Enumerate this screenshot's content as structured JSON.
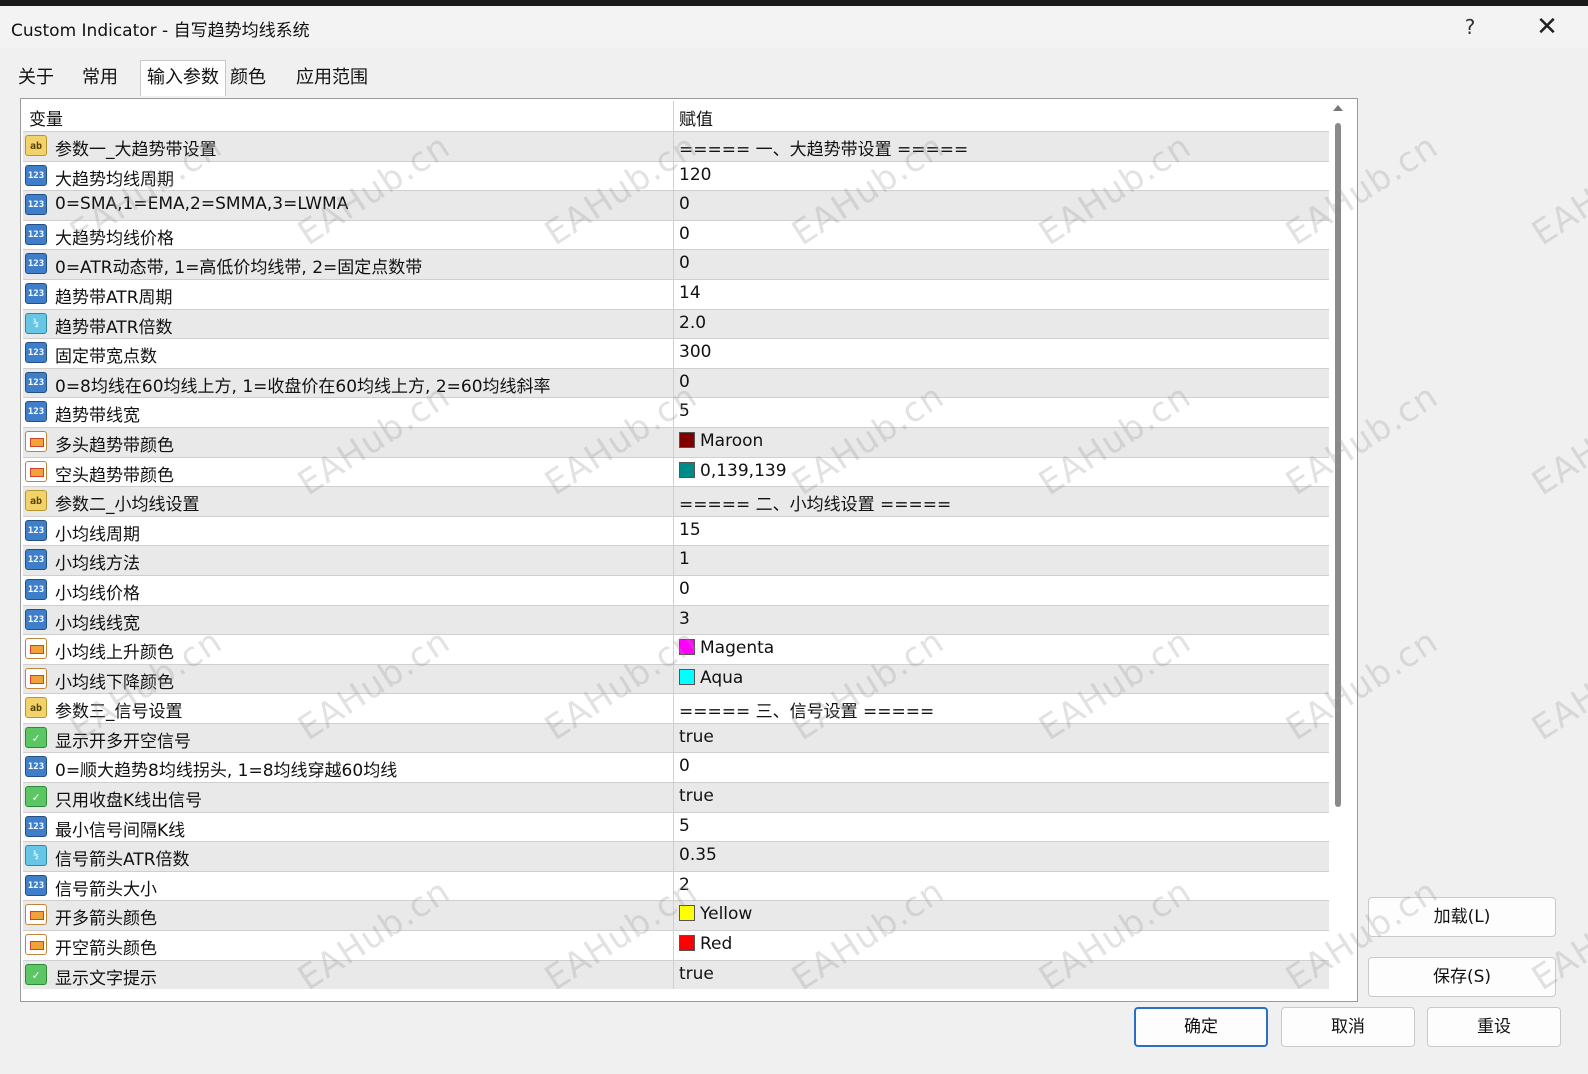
{
  "window": {
    "title": "Custom Indicator - 自写趋势均线系统",
    "help_glyph": "?",
    "close_glyph": "✕"
  },
  "tabs": [
    {
      "label": "关于"
    },
    {
      "label": "常用"
    },
    {
      "label": "输入参数"
    },
    {
      "label": "颜色"
    },
    {
      "label": "应用范围"
    }
  ],
  "active_tab": "输入参数",
  "table": {
    "header_variable": "变量",
    "header_value": "赋值",
    "rows": [
      {
        "type": "ab",
        "name": "参数一_大趋势带设置",
        "value": "===== 一、大趋势带设置 ====="
      },
      {
        "type": "int",
        "name": "大趋势均线周期",
        "value": "120"
      },
      {
        "type": "int",
        "name": "0=SMA,1=EMA,2=SMMA,3=LWMA",
        "value": "0"
      },
      {
        "type": "int",
        "name": "大趋势均线价格",
        "value": "0"
      },
      {
        "type": "int",
        "name": "0=ATR动态带, 1=高低价均线带, 2=固定点数带",
        "value": "0"
      },
      {
        "type": "int",
        "name": "趋势带ATR周期",
        "value": "14"
      },
      {
        "type": "dbl",
        "name": "趋势带ATR倍数",
        "value": "2.0"
      },
      {
        "type": "int",
        "name": "固定带宽点数",
        "value": "300"
      },
      {
        "type": "int",
        "name": "0=8均线在60均线上方, 1=收盘价在60均线上方, 2=60均线斜率",
        "value": "0"
      },
      {
        "type": "int",
        "name": "趋势带线宽",
        "value": "5"
      },
      {
        "type": "clr",
        "name": "多头趋势带颜色",
        "value": "Maroon",
        "swatch": "#800000"
      },
      {
        "type": "clr",
        "name": "空头趋势带颜色",
        "value": "0,139,139",
        "swatch": "#008b8b"
      },
      {
        "type": "ab",
        "name": "参数二_小均线设置",
        "value": "===== 二、小均线设置 ====="
      },
      {
        "type": "int",
        "name": "小均线周期",
        "value": "15"
      },
      {
        "type": "int",
        "name": "小均线方法",
        "value": "1"
      },
      {
        "type": "int",
        "name": "小均线价格",
        "value": "0"
      },
      {
        "type": "int",
        "name": "小均线线宽",
        "value": "3"
      },
      {
        "type": "clr",
        "name": "小均线上升颜色",
        "value": "Magenta",
        "swatch": "#ff00ff"
      },
      {
        "type": "clr",
        "name": "小均线下降颜色",
        "value": "Aqua",
        "swatch": "#00ffff"
      },
      {
        "type": "ab",
        "name": "参数三_信号设置",
        "value": "===== 三、信号设置 ====="
      },
      {
        "type": "bool",
        "name": "显示开多开空信号",
        "value": "true"
      },
      {
        "type": "int",
        "name": "0=顺大趋势8均线拐头, 1=8均线穿越60均线",
        "value": "0"
      },
      {
        "type": "bool",
        "name": "只用收盘K线出信号",
        "value": "true"
      },
      {
        "type": "int",
        "name": "最小信号间隔K线",
        "value": "5"
      },
      {
        "type": "dbl",
        "name": "信号箭头ATR倍数",
        "value": "0.35"
      },
      {
        "type": "int",
        "name": "信号箭头大小",
        "value": "2"
      },
      {
        "type": "clr",
        "name": "开多箭头颜色",
        "value": "Yellow",
        "swatch": "#ffff00"
      },
      {
        "type": "clr",
        "name": "开空箭头颜色",
        "value": "Red",
        "swatch": "#ff0000"
      },
      {
        "type": "bool",
        "name": "显示文字提示",
        "value": "true"
      }
    ]
  },
  "side_buttons": {
    "load": "加载(L)",
    "save": "保存(S)"
  },
  "footer_buttons": {
    "ok": "确定",
    "cancel": "取消",
    "reset": "重设"
  },
  "icon_glyphs": {
    "ab": "ab",
    "int": "123",
    "dbl": "½",
    "bool": "✓",
    "clr": ""
  },
  "watermark": "EAHub.cn"
}
